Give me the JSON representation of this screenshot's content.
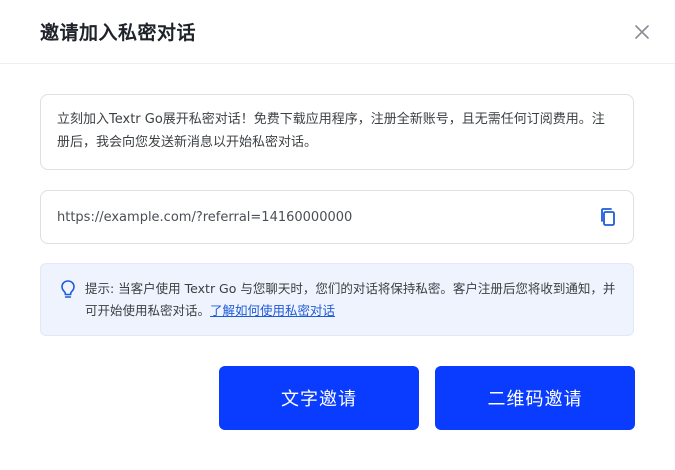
{
  "dialog": {
    "title": "邀请加入私密对话"
  },
  "message": {
    "text": "立刻加入Textr Go展开私密对话！免费下载应用程序，注册全新账号，且无需任何订阅费用。注册后，我会向您发送新消息以开始私密对话。"
  },
  "invite_link": {
    "url": "https://example.com/?referral=14160000000"
  },
  "tip": {
    "text": "提示: 当客户使用 Textr Go 与您聊天时，您们的对话将保持私密。客户注册后您将收到通知，并可开始使用私密对话。",
    "link_label": "了解如何使用私密对话"
  },
  "buttons": {
    "text_invite": "文字邀请",
    "qr_invite": "二维码邀请"
  },
  "icons": {
    "close": "close-icon",
    "copy": "copy-icon",
    "tip": "lightbulb-icon"
  },
  "colors": {
    "primary": "#0A3CFF",
    "link": "#1F5BD8",
    "tip_background": "#EEF3FD"
  }
}
